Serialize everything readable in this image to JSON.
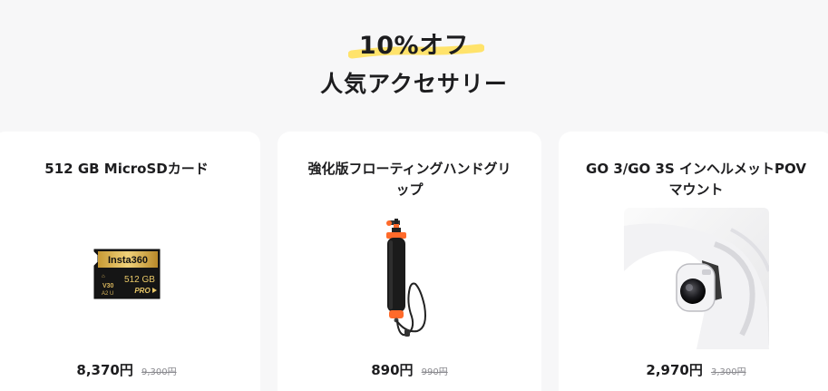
{
  "header": {
    "discount_label": "10%オフ",
    "subtitle": "人気アクセサリー",
    "highlight_color": "#ffe36b"
  },
  "products": [
    {
      "title": "512 GB MicroSDカード",
      "price": "8,370円",
      "original_price": "9,300円",
      "image": "microsd-card-icon",
      "card_brand": "Insta360",
      "card_capacity": "512 GB",
      "card_tier": "PRO"
    },
    {
      "title": "強化版フローティングハンドグリップ",
      "price": "890円",
      "original_price": "990円",
      "image": "floating-hand-grip-icon"
    },
    {
      "title": "GO 3/GO 3S インヘルメットPOVマウント",
      "price": "2,970円",
      "original_price": "3,300円",
      "image": "helmet-pov-mount-photo"
    }
  ]
}
